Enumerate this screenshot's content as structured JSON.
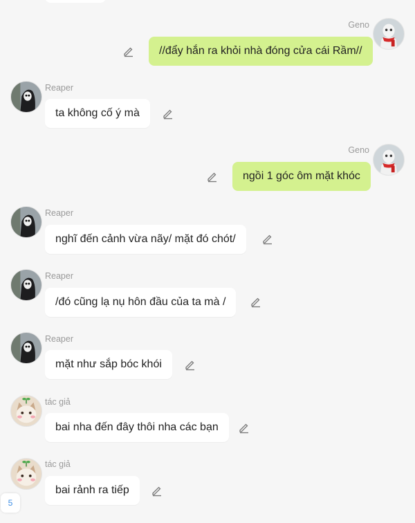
{
  "messages": [
    {
      "speaker": "Geno",
      "side": "right",
      "text": "//đẩy hắn ra khỏi nhà đóng cửa cái Rầm//",
      "avatar": "geno"
    },
    {
      "speaker": "Reaper",
      "side": "left",
      "text": "ta không cố ý mà",
      "avatar": "reaper"
    },
    {
      "speaker": "Geno",
      "side": "right",
      "text": "ngồi 1 góc ôm mặt khóc",
      "avatar": "geno"
    },
    {
      "speaker": "Reaper",
      "side": "left",
      "text": "nghĩ đến cảnh vừa  nãy/ mặt đó chót/",
      "avatar": "reaper"
    },
    {
      "speaker": "Reaper",
      "side": "left",
      "text": "/đó cũng lạ nụ hôn đầu của ta mà /",
      "avatar": "reaper"
    },
    {
      "speaker": "Reaper",
      "side": "left",
      "text": "mặt như sắp bóc khói",
      "avatar": "reaper"
    },
    {
      "speaker": "tác giả",
      "side": "left",
      "text": "bai nha đến đây thôi nha các bạn",
      "avatar": "author"
    },
    {
      "speaker": "tác giả",
      "side": "left",
      "text": "bai rảnh ra tiếp",
      "avatar": "author"
    }
  ],
  "page_badge": "5",
  "colors": {
    "background": "#f6f6f6",
    "bubble_left": "#ffffff",
    "bubble_right": "#d4f18f",
    "name_text": "#9a9a9a",
    "page_badge_text": "#3d8ee5"
  },
  "icons": {
    "edit": "pencil-edit-icon",
    "avatar_geno": "skeleton-red-scarf-avatar",
    "avatar_reaper": "hooded-figure-avatar",
    "avatar_author": "cat-with-sprout-avatar"
  }
}
